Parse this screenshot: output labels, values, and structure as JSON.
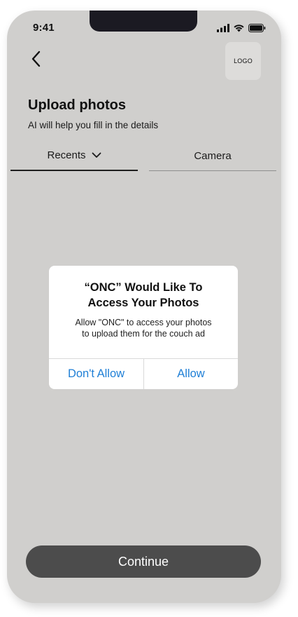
{
  "status_bar": {
    "time": "9:41",
    "icons": [
      "cellular-signal-icon",
      "wifi-icon",
      "battery-icon"
    ]
  },
  "header": {
    "back_icon": "chevron-left-icon",
    "logo_text": "LOGO"
  },
  "page": {
    "title": "Upload photos",
    "subtitle": "AI will help you fill in the details"
  },
  "tabs": [
    {
      "label": "Recents",
      "active": true,
      "icon": "chevron-down-icon"
    },
    {
      "label": "Camera",
      "active": false
    }
  ],
  "permission_dialog": {
    "title": "“ONC” Would Like To\nAccess Your Photos",
    "message": "Allow \"ONC\" to access your photos\nto upload them for the couch ad",
    "deny_label": "Don't Allow",
    "allow_label": "Allow"
  },
  "footer": {
    "continue_label": "Continue"
  },
  "colors": {
    "screen_background": "#d0cfcd",
    "dialog_button_text": "#1f7fd6",
    "continue_button": "#4c4c4c",
    "notch": "#1b1a22"
  }
}
